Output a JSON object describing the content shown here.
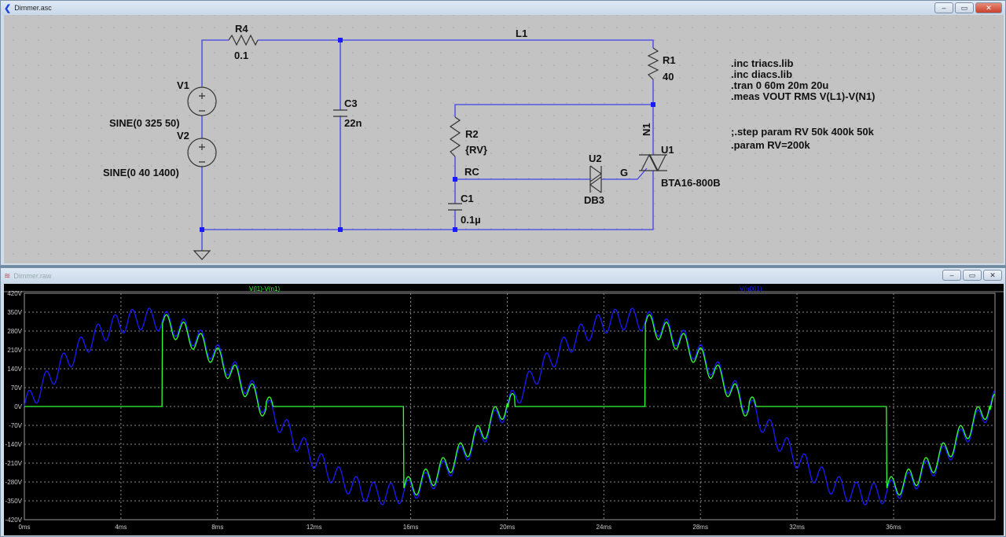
{
  "schematic_window": {
    "title": "Dimmer.asc",
    "icon": "ltspice-schematic-icon"
  },
  "plot_window": {
    "title": "Dimmer.raw",
    "icon": "waveform-icon"
  },
  "window_controls": {
    "minimize": "–",
    "maximize": "▭",
    "close": "✕"
  },
  "components": {
    "R4": {
      "name": "R4",
      "value": "0.1"
    },
    "R1": {
      "name": "R1",
      "value": "40"
    },
    "R2": {
      "name": "R2",
      "value": "{RV}"
    },
    "C3": {
      "name": "C3",
      "value": "22n"
    },
    "C1": {
      "name": "C1",
      "value": "0.1µ"
    },
    "V1": {
      "name": "V1",
      "value": "SINE(0 325 50)"
    },
    "V2": {
      "name": "V2",
      "value": "SINE(0 40 1400)"
    },
    "U1": {
      "name": "U1",
      "value": "BTA16-800B"
    },
    "U2": {
      "name": "U2",
      "value": "DB3"
    }
  },
  "net_labels": {
    "L1": "L1",
    "N1": "N1",
    "RC": "RC",
    "G": "G"
  },
  "directives": [
    ".inc triacs.lib",
    ".inc diacs.lib",
    ".tran 0 60m 20m 20u",
    ".meas VOUT  RMS V(L1)-V(N1)"
  ],
  "directives2": [
    ";.step param RV 50k 400k 50k",
    ".param RV=200k"
  ],
  "colors": {
    "wire": "#4040e8",
    "trace_green": "#33ff33",
    "trace_blue": "#1a1aff",
    "grid": "#9a9a9a"
  },
  "chart_data": {
    "type": "line",
    "xlabel": "",
    "ylabel": "",
    "xlim": [
      0,
      40.2
    ],
    "ylim": [
      -420,
      420
    ],
    "x_unit": "ms",
    "xticks": [
      "0ms",
      "4ms",
      "8ms",
      "12ms",
      "16ms",
      "20ms",
      "24ms",
      "28ms",
      "32ms",
      "36ms"
    ],
    "yticks": [
      "420V",
      "350V",
      "280V",
      "210V",
      "140V",
      "70V",
      "0V",
      "-70V",
      "-140V",
      "-210V",
      "-280V",
      "-350V",
      "-420V"
    ],
    "grid": true,
    "series": [
      {
        "name": "V(l1)-V(n1)",
        "color": "#33ff33",
        "model": "triac-conducting portion of V(n001)",
        "firing_delay_ms": 5.7,
        "turnoff_after_zero_ms": 0.3,
        "drop_v": 12
      },
      {
        "name": "V(n001)",
        "color": "#1a1aff",
        "model": "325*sin(2π·50·t)+40*sin(2π·1400·t)",
        "amplitude_main_v": 325,
        "freq_main_hz": 50,
        "amplitude_ripple_v": 40,
        "freq_ripple_hz": 1400
      }
    ]
  }
}
